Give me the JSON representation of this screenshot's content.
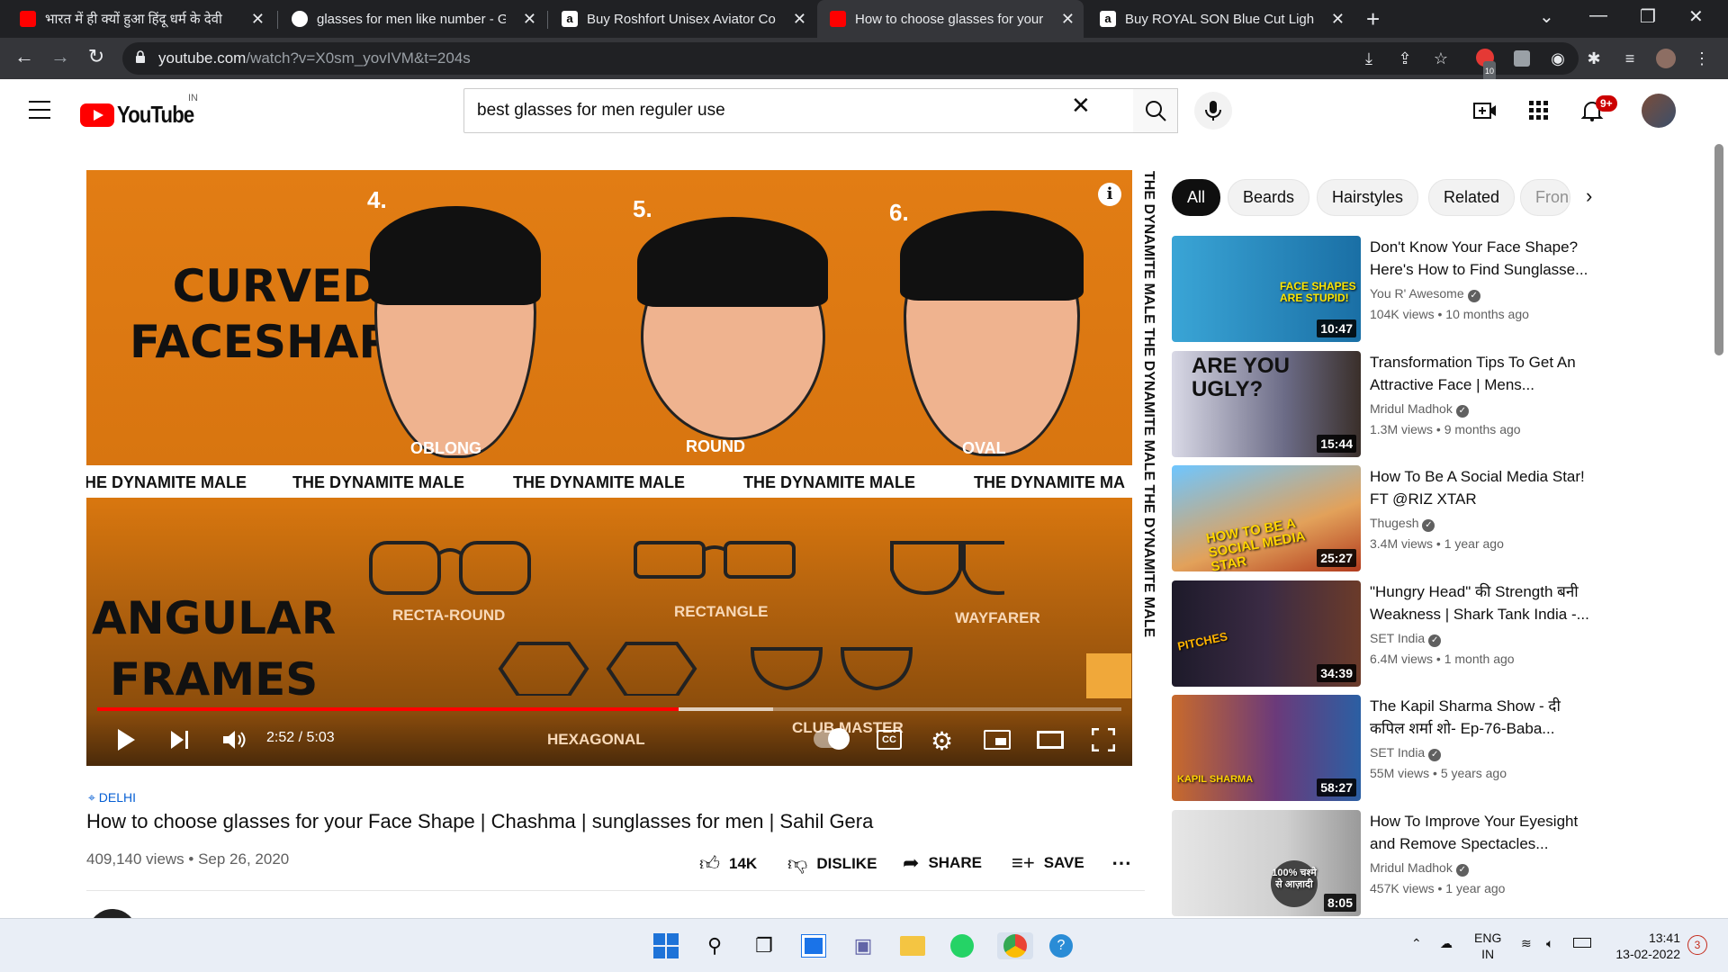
{
  "browser": {
    "tabs": [
      {
        "title": "भारत में ही क्यों हुआ हिंदू धर्म के देवी",
        "favicon": "youtube-icon",
        "active": false
      },
      {
        "title": "glasses for men like number - Go",
        "favicon": "google-icon",
        "active": false
      },
      {
        "title": "Buy Roshfort Unisex Aviator Com",
        "favicon": "amazon-icon",
        "active": false
      },
      {
        "title": "How to choose glasses for your F",
        "favicon": "youtube-icon",
        "active": true
      },
      {
        "title": "Buy ROYAL SON Blue Cut Light/R",
        "favicon": "amazon-icon",
        "active": false
      }
    ],
    "url_host": "youtube.com",
    "url_rest": "/watch?v=X0sm_yovIVM&t=204s",
    "ext_badge": "10"
  },
  "youtube": {
    "logo_text": "YouTube",
    "country": "IN",
    "search_query": "best glasses for men reguler use",
    "notification_badge": "9+",
    "colors": {
      "brand_red": "#ff0000",
      "link_blue": "#065fd4"
    }
  },
  "video": {
    "overlay": {
      "heading_top": [
        "CURVED",
        "FACESHAPE"
      ],
      "numbers": [
        "4.",
        "5.",
        "6."
      ],
      "face_labels": [
        "OBLONG",
        "ROUND",
        "OVAL"
      ],
      "strip_text": [
        "HE DYNAMITE MALE",
        "THE DYNAMITE MALE",
        "THE DYNAMITE MALE",
        "THE DYNAMITE MALE",
        "THE DYNAMITE MA"
      ],
      "side_text": "THE DYNAMITE MALE   THE DYNAMITE MALE   THE DYNAMITE MALE",
      "heading_bottom": [
        "ANGULAR",
        "FRAMES"
      ],
      "frame_labels": [
        "RECTA-ROUND",
        "RECTANGLE",
        "WAYFARER",
        "HEXAGONAL",
        "CLUB MASTER"
      ]
    },
    "current_time": "2:52",
    "duration": "5:03",
    "time_display": "2:52 / 5:03",
    "progress_fraction": 0.568,
    "buffered_fraction": 0.66,
    "location": "DELHI",
    "title": "How to choose glasses for your Face Shape | Chashma | sunglasses for men | Sahil Gera",
    "views": "409,140 views",
    "date": "Sep 26, 2020",
    "views_date": "409,140 views • Sep 26, 2020",
    "likes": "14K",
    "dislike_label": "DISLIKE",
    "share_label": "SHARE",
    "save_label": "SAVE"
  },
  "chips": [
    "All",
    "Beards",
    "Hairstyles",
    "Related",
    "Fron"
  ],
  "recommendations": [
    {
      "title": "Don't Know Your Face Shape? Here's How to Find Sunglasse...",
      "channel": "You R' Awesome",
      "views": "104K views",
      "age": "10 months ago",
      "duration": "10:47",
      "thumb_text": "FACE SHAPES ARE STUPID!"
    },
    {
      "title": "Transformation Tips To Get An Attractive Face | Mens...",
      "channel": "Mridul Madhok",
      "views": "1.3M views",
      "age": "9 months ago",
      "duration": "15:44",
      "thumb_text": "ARE YOU UGLY?"
    },
    {
      "title": "How To Be A Social Media Star! FT @RIZ XTAR",
      "channel": "Thugesh",
      "views": "3.4M views",
      "age": "1 year ago",
      "duration": "25:27",
      "thumb_text": "HOW TO BE A SOCIAL MEDIA STAR"
    },
    {
      "title": "\"Hungry Head\" की Strength बनी Weakness | Shark Tank India -...",
      "channel": "SET India",
      "views": "6.4M views",
      "age": "1 month ago",
      "duration": "34:39",
      "thumb_text": "PITCHES"
    },
    {
      "title": "The Kapil Sharma Show - दी कपिल शर्मा शो- Ep-76-Baba...",
      "channel": "SET India",
      "views": "55M views",
      "age": "5 years ago",
      "duration": "58:27",
      "thumb_text": "KAPIL SHARMA"
    },
    {
      "title": "How To Improve Your Eyesight and Remove Spectacles...",
      "channel": "Mridul Madhok",
      "views": "457K views",
      "age": "1 year ago",
      "duration": "8:05",
      "thumb_text": "100% चश्मे से आज़ादी"
    }
  ],
  "taskbar": {
    "lang_top": "ENG",
    "lang_bottom": "IN",
    "time": "13:41",
    "date": "13-02-2022",
    "notification_count": "3"
  }
}
